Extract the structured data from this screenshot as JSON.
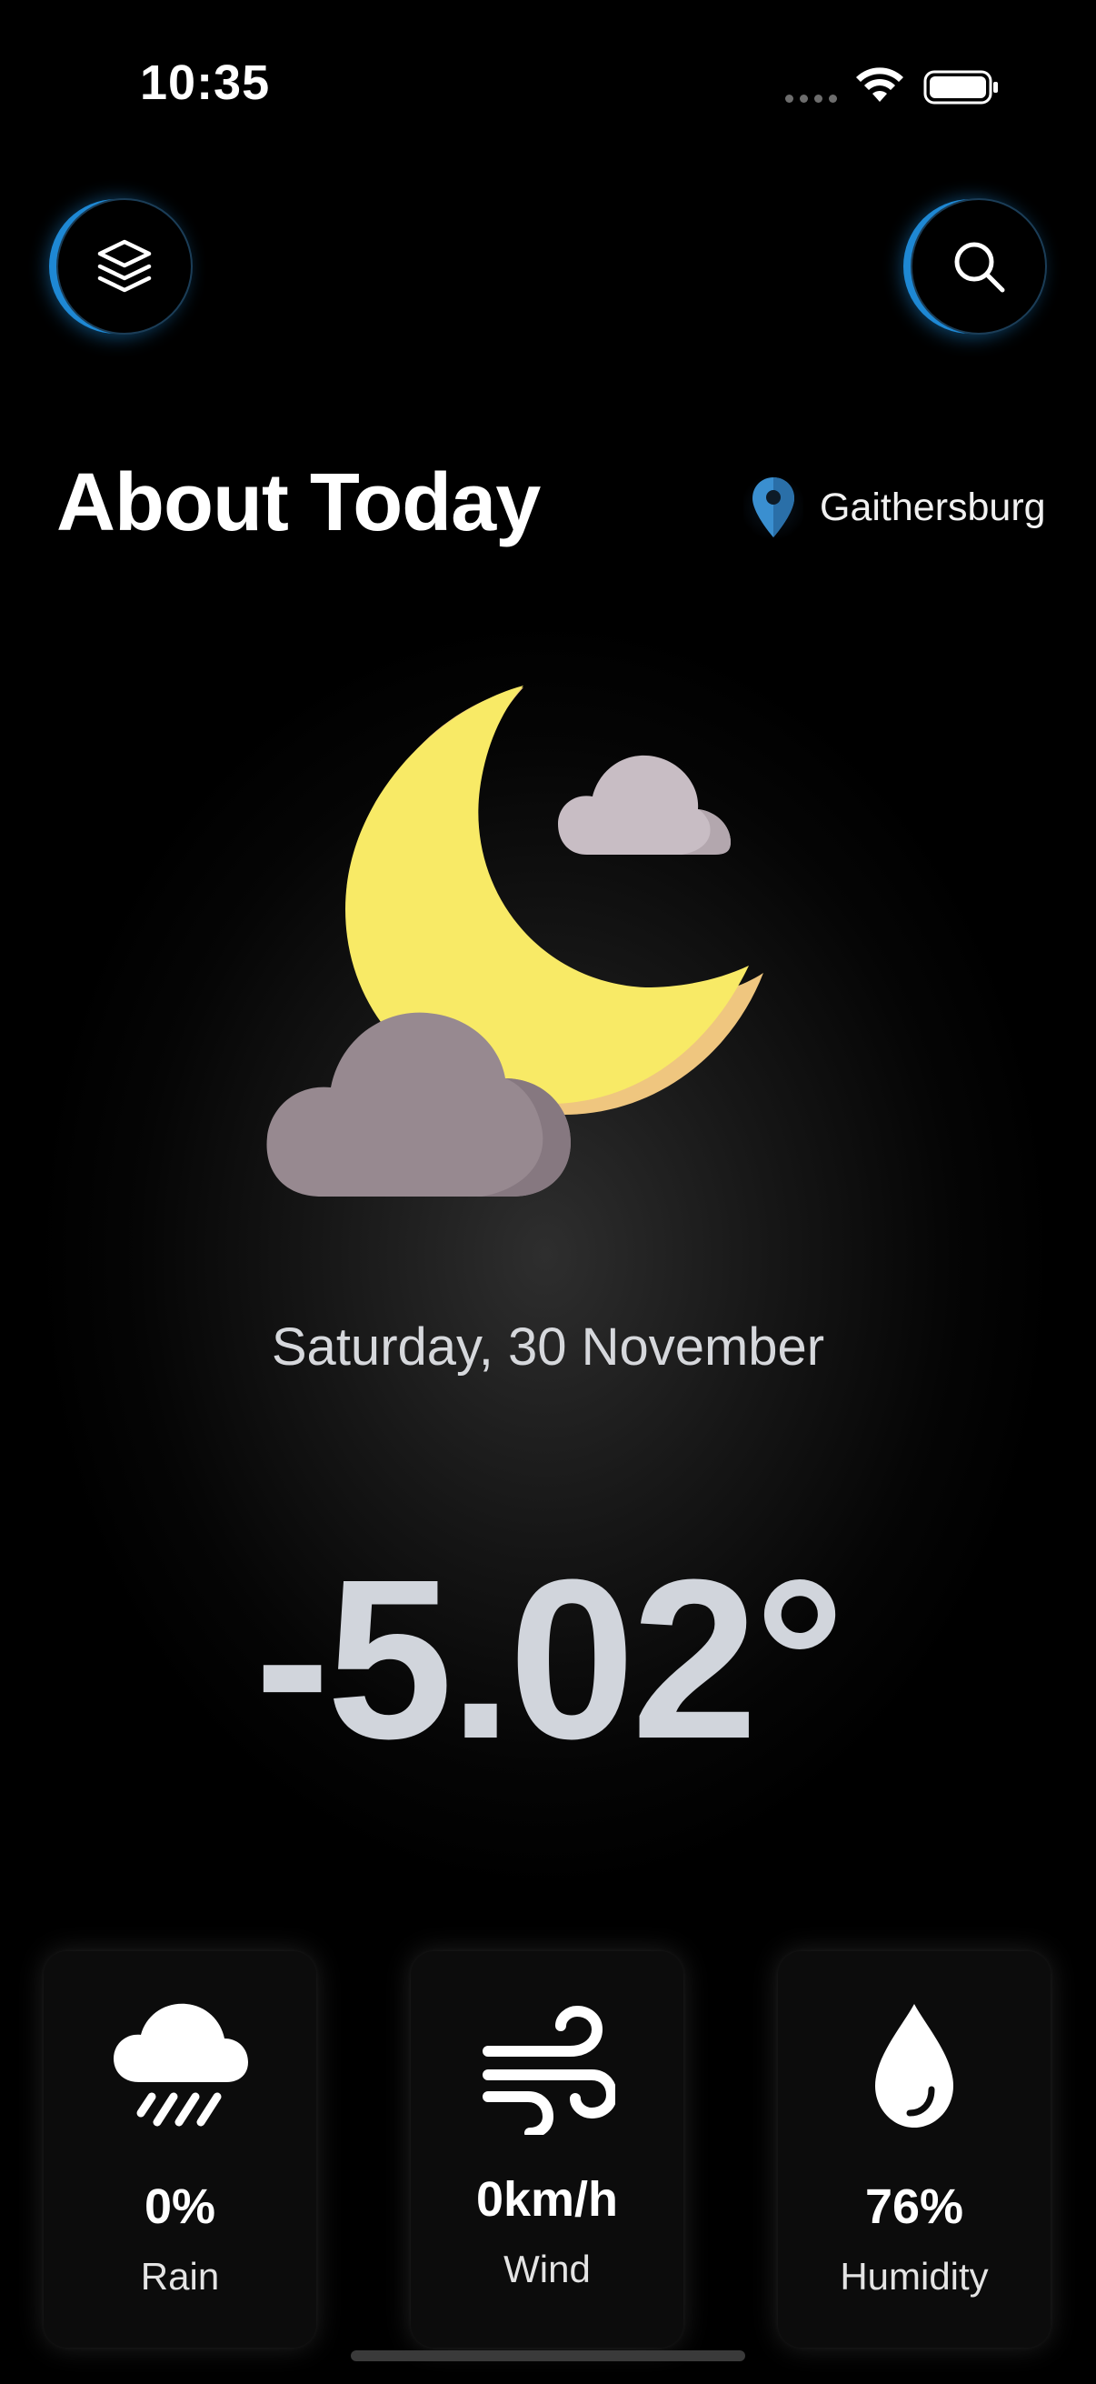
{
  "status_bar": {
    "time": "10:35",
    "icons": [
      "cellular-dots-icon",
      "wifi-icon",
      "battery-icon"
    ]
  },
  "header": {
    "left_button_icon": "layers-icon",
    "right_button_icon": "search-icon",
    "accent_color": "#1e88d4"
  },
  "title": "About Today",
  "location": {
    "icon": "map-pin-icon",
    "name": "Gaithersburg"
  },
  "weather": {
    "icon": "moon-with-clouds-icon",
    "date": "Saturday, 30 November",
    "temperature": "-5.02°"
  },
  "stats": {
    "rain": {
      "icon": "rain-cloud-icon",
      "value": "0%",
      "label": "Rain"
    },
    "wind": {
      "icon": "wind-icon",
      "value": "0km/h",
      "label": "Wind"
    },
    "humidity": {
      "icon": "water-drop-icon",
      "value": "76%",
      "label": "Humidity"
    }
  }
}
